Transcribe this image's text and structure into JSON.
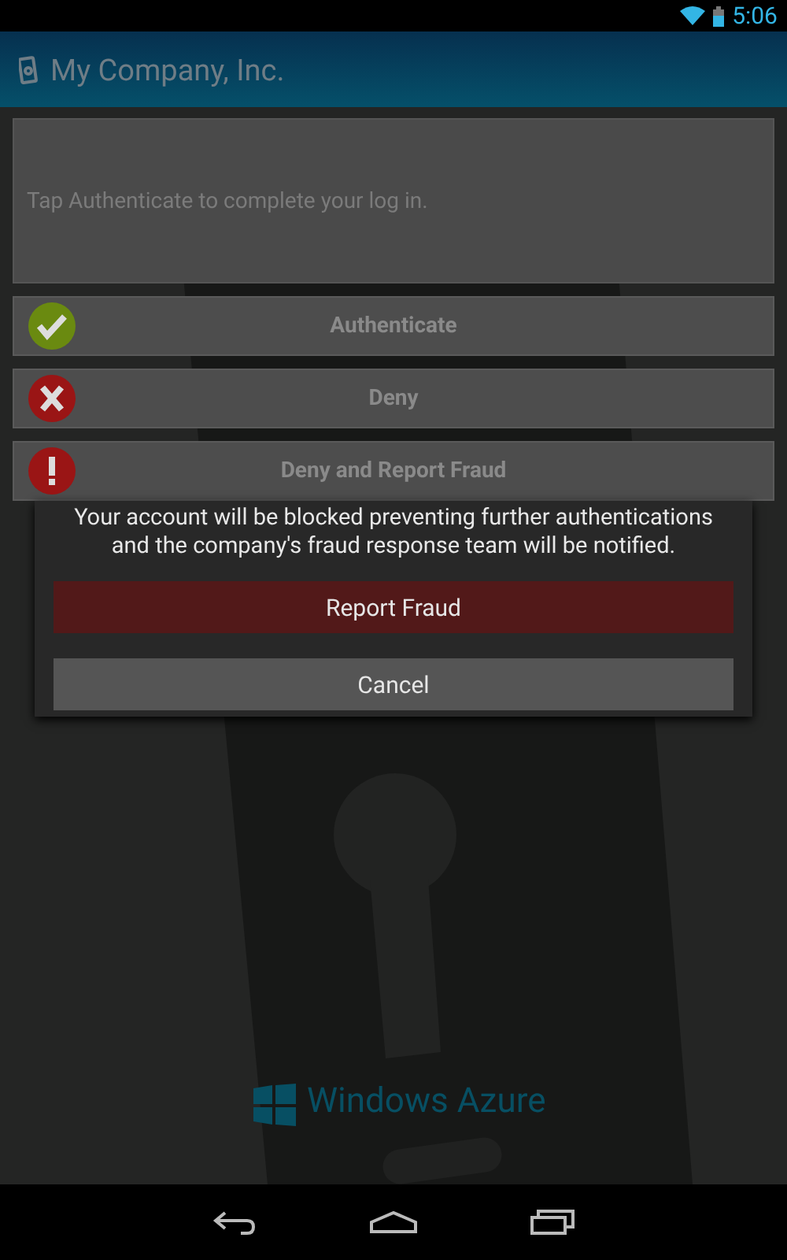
{
  "status_bar": {
    "time": "5:06"
  },
  "app_bar": {
    "title": "My Company, Inc."
  },
  "message": "Tap Authenticate to complete your log in.",
  "actions": [
    {
      "kind": "approve",
      "label": "Authenticate"
    },
    {
      "kind": "deny",
      "label": "Deny"
    },
    {
      "kind": "report",
      "label": "Deny and Report Fraud"
    }
  ],
  "dialog": {
    "text": "Your account will be blocked preventing further authentications and the company's fraud response team will be notified.",
    "buttons": [
      {
        "kind": "primary",
        "label": "Report Fraud"
      },
      {
        "kind": "secondary",
        "label": "Cancel"
      }
    ]
  },
  "background": {
    "brand": "Windows Azure"
  }
}
